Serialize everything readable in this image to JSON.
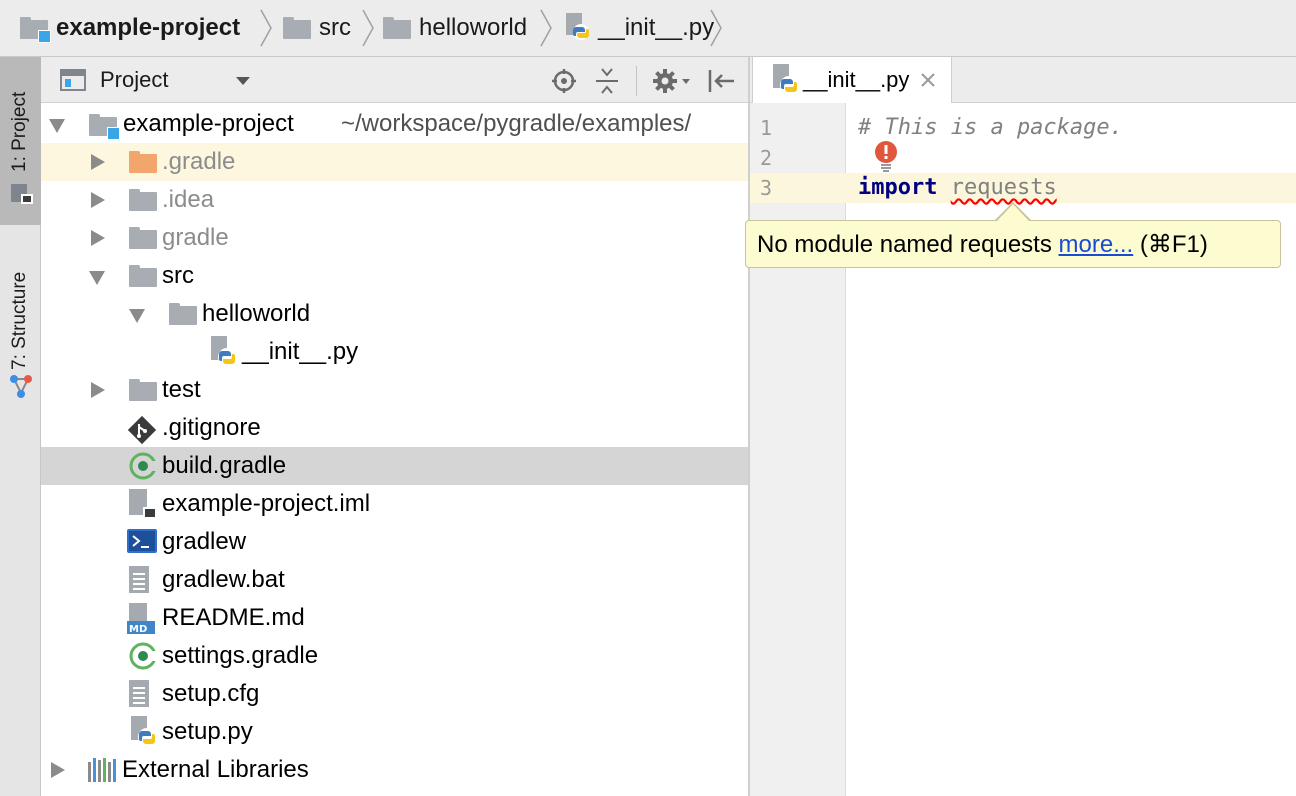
{
  "breadcrumbs": [
    {
      "label": "example-project",
      "icon": "module-folder-icon"
    },
    {
      "label": "src",
      "icon": "folder-icon"
    },
    {
      "label": "helloworld",
      "icon": "folder-icon"
    },
    {
      "label": "__init__.py",
      "icon": "python-file-icon"
    }
  ],
  "tool_windows": {
    "project": "1: Project",
    "structure": "7: Structure"
  },
  "project_panel": {
    "title": "Project",
    "actions": [
      "locate-icon",
      "collapse-all-icon",
      "settings-icon",
      "hide-icon"
    ]
  },
  "tree": {
    "root_name": "example-project",
    "root_path": "~/workspace/pygradle/examples/",
    "items": [
      {
        "label": ".gradle"
      },
      {
        "label": ".idea"
      },
      {
        "label": "gradle"
      },
      {
        "label": "src"
      },
      {
        "label": "helloworld"
      },
      {
        "label": "__init__.py"
      },
      {
        "label": "test"
      },
      {
        "label": ".gitignore"
      },
      {
        "label": "build.gradle"
      },
      {
        "label": "example-project.iml"
      },
      {
        "label": "gradlew"
      },
      {
        "label": "gradlew.bat"
      },
      {
        "label": "README.md"
      },
      {
        "label": "settings.gradle"
      },
      {
        "label": "setup.cfg"
      },
      {
        "label": "setup.py"
      },
      {
        "label": "External Libraries"
      }
    ]
  },
  "editor": {
    "tab_label": "__init__.py",
    "line_numbers": [
      "1",
      "2",
      "3"
    ],
    "line1_comment": "# This is a package.",
    "line3_keyword": "import",
    "line3_module": "requests"
  },
  "tooltip": {
    "message": "No module named requests",
    "link": "more...",
    "shortcut": "(⌘F1)"
  },
  "colors": {
    "selected_row": "#d5d5d5",
    "highlight_row": "#fdf7df",
    "current_line": "#fcf7dc",
    "tooltip_bg": "#fdfbd0",
    "link": "#1a4bd6"
  }
}
